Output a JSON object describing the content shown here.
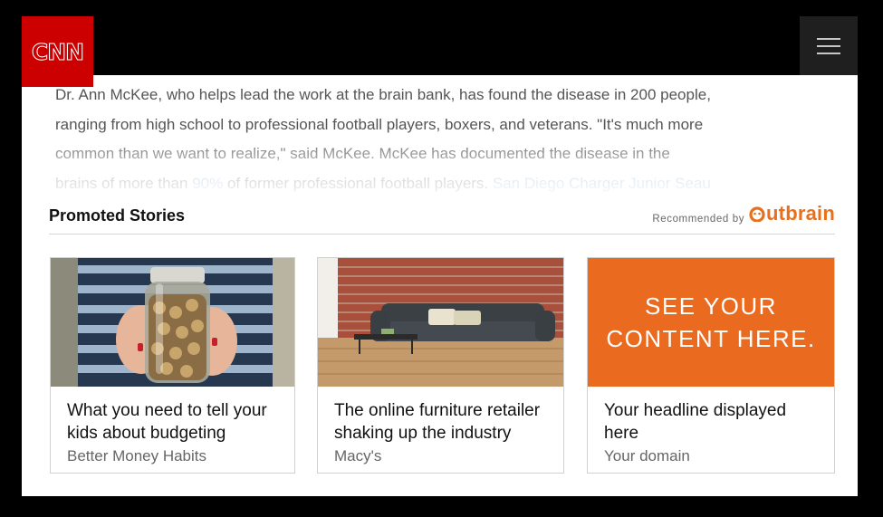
{
  "header": {
    "logo_text": "CNN",
    "menu_icon": "hamburger-menu-icon"
  },
  "article": {
    "line1": "Dr. Ann McKee, who helps lead the work at the brain bank, has found the disease in 200 people,",
    "line2": "ranging from high school to professional football players, boxers, and veterans. \"It's much more",
    "line3": "common than we want to realize,\" said McKee. McKee has documented the disease in the",
    "line4_pre": "brains of more than ",
    "line4_link1": "90%",
    "line4_mid": " of former professional football players. ",
    "line4_link2": "San Diego Charger Junior Seau"
  },
  "promoted": {
    "title": "Promoted Stories",
    "recommended_by": "Recommended by",
    "provider": "Outbrain",
    "provider_color": "#e8701c"
  },
  "cards": [
    {
      "headline": "What you need to tell your kids about budgeting",
      "source": "Better Money Habits",
      "image": "coin-jar-photo"
    },
    {
      "headline": "The online furniture retailer shaking up the industry",
      "source": "Macy's",
      "image": "sofa-brick-wall-photo"
    },
    {
      "headline": "Your headline displayed here",
      "source": "Your domain",
      "image_text_line1": "SEE YOUR",
      "image_text_line2": "CONTENT HERE.",
      "image_color": "#ea6b1f"
    }
  ]
}
